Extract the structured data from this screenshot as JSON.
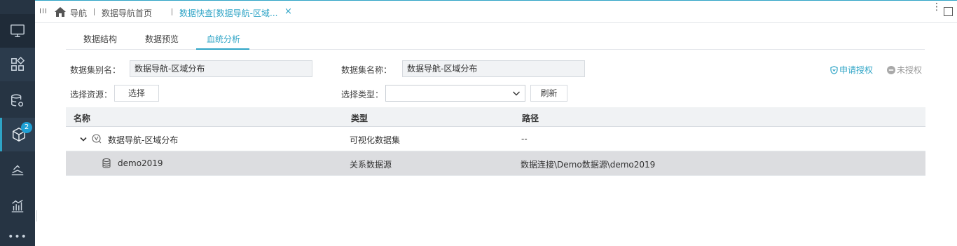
{
  "sidebar": {
    "items": [
      {
        "icon": "monitor-icon"
      },
      {
        "icon": "apps-grid-icon"
      },
      {
        "icon": "database-settings-icon"
      },
      {
        "icon": "cube-icon",
        "badge": "2"
      },
      {
        "icon": "layers-chart-icon"
      },
      {
        "icon": "bar-chart-icon"
      }
    ],
    "more_label": "•••"
  },
  "topbar": {
    "menu_glyph": "III",
    "tabs": [
      {
        "label": "导航"
      },
      {
        "label": "数据导航首页"
      },
      {
        "label": "数据快查[数据导航-区域..."
      }
    ],
    "close_glyph": "×",
    "more_glyph": "⋮"
  },
  "subtabs": [
    {
      "label": "数据结构"
    },
    {
      "label": "数据预览"
    },
    {
      "label": "血统分析"
    }
  ],
  "form": {
    "alias_label": "数据集别名：",
    "alias_value": "数据导航-区域分布",
    "name_label": "数据集名称：",
    "name_value": "数据导航-区域分布",
    "apply_auth": "申请授权",
    "unauthorized": "未授权",
    "select_resource_label": "选择资源：",
    "select_button": "选择",
    "select_type_label": "选择类型：",
    "select_type_value": "",
    "refresh_button": "刷新"
  },
  "table": {
    "columns": [
      "名称",
      "类型",
      "路径"
    ],
    "rows": [
      {
        "name": "数据导航-区域分布",
        "type": "可视化数据集",
        "path": "--"
      },
      {
        "name": "demo2019",
        "type": "关系数据源",
        "path": "数据连接\\Demo数据源\\demo2019"
      }
    ]
  },
  "colors": {
    "accent": "#2ea4c6",
    "sidebar_bg": "#263443",
    "selected_row": "#dcdde0"
  }
}
